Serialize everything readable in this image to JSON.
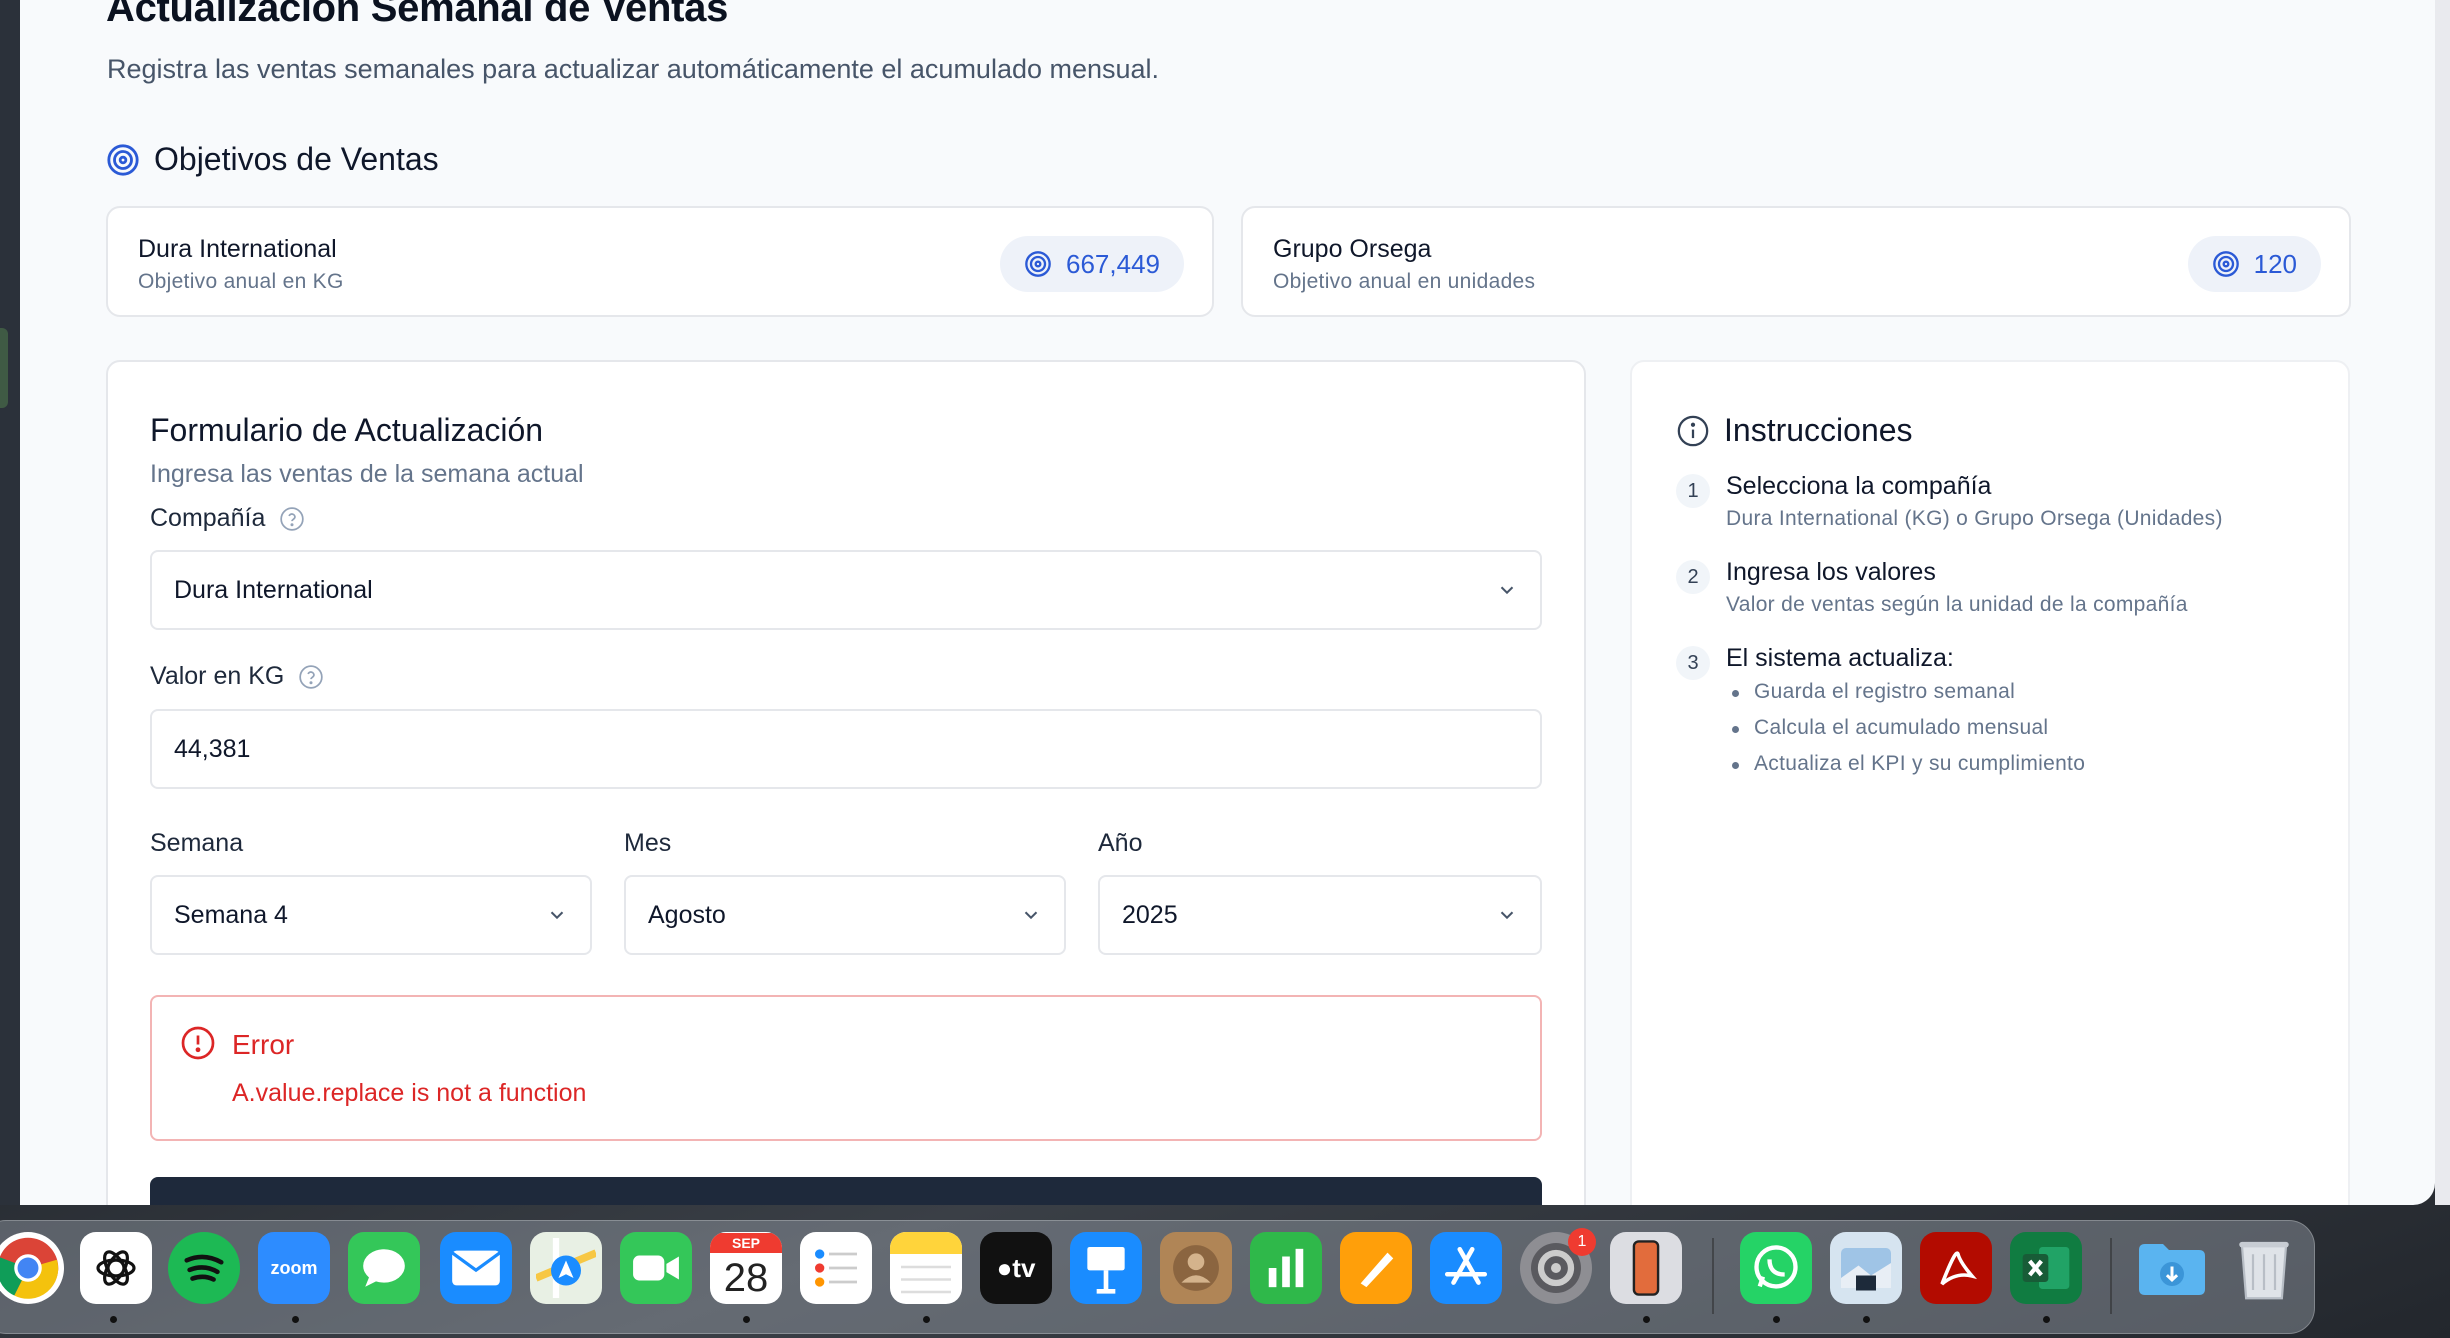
{
  "page": {
    "title": "Actualización Semanal de Ventas",
    "subtitle": "Registra las ventas semanales para actualizar automáticamente el acumulado mensual."
  },
  "objectives": {
    "title": "Objetivos de Ventas",
    "cards": [
      {
        "name": "Dura International",
        "description": "Objetivo anual en KG",
        "value": "667,449"
      },
      {
        "name": "Grupo Orsega",
        "description": "Objetivo anual en unidades",
        "value": "120"
      }
    ]
  },
  "form": {
    "title": "Formulario de Actualización",
    "subtitle": "Ingresa las ventas de la semana actual",
    "company_label": "Compañía",
    "company_value": "Dura International",
    "value_label": "Valor en KG",
    "value_value": "44,381",
    "week_label": "Semana",
    "week_value": "Semana 4",
    "month_label": "Mes",
    "month_value": "Agosto",
    "year_label": "Año",
    "year_value": "2025",
    "error": {
      "title": "Error",
      "message": "A.value.replace is not a function"
    }
  },
  "instructions": {
    "title": "Instrucciones",
    "steps": [
      {
        "num": "1",
        "title": "Selecciona la compañía",
        "desc": "Dura International (KG) o Grupo Orsega (Unidades)"
      },
      {
        "num": "2",
        "title": "Ingresa los valores",
        "desc": "Valor de ventas según la unidad de la compañía"
      },
      {
        "num": "3",
        "title": "El sistema actualiza:",
        "bullets": [
          "Guarda el registro semanal",
          "Calcula el acumulado mensual",
          "Actualiza el KPI y su cumplimiento"
        ]
      }
    ]
  },
  "dock": {
    "calendar": {
      "month": "SEP",
      "day": "28"
    },
    "zoom_label": "zoom",
    "tv_label": "tv",
    "settings_badge": "1",
    "apps": [
      "chrome-icon",
      "chatgpt-icon",
      "spotify-icon",
      "zoom-icon",
      "messages-icon",
      "mail-icon",
      "maps-icon",
      "facetime-icon",
      "calendar-icon",
      "reminders-icon",
      "notes-icon",
      "appletv-icon",
      "keynote-icon",
      "contacts-icon",
      "numbers-icon",
      "pages-icon",
      "appstore-icon",
      "settings-icon",
      "iphone-mirroring-icon",
      "whatsapp-icon",
      "preview-icon",
      "acrobat-icon",
      "excel-icon",
      "downloads-icon",
      "trash-icon"
    ]
  },
  "colors": {
    "accent": "#2b5ad6",
    "error": "#dc2626",
    "primary_button": "#1e293b"
  }
}
